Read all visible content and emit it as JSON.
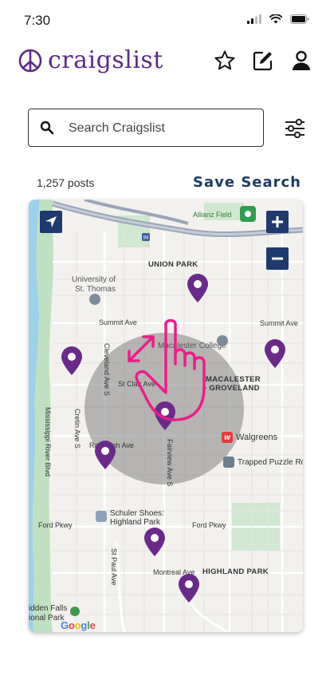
{
  "status": {
    "time": "7:30"
  },
  "header": {
    "logo_text": "craigslist",
    "icons": [
      "star-icon",
      "edit-icon",
      "user-icon"
    ]
  },
  "search": {
    "placeholder": "Search Craigslist"
  },
  "results": {
    "count": "1,257 posts",
    "save_label": "Save Search"
  },
  "map": {
    "labels": {
      "allianz": "Allianz Field",
      "union_park": "UNION PARK",
      "st_thomas_1": "University of",
      "st_thomas_2": "St. Thomas",
      "summit_w": "Summit Ave",
      "summit_e": "Summit Ave",
      "macalester_college": "Macalester College",
      "macalester_groveland_1": "MACALESTER",
      "macalester_groveland_2": "- GROVELAND",
      "st_clair": "St Clair Ave",
      "cleveland": "Cleveland Ave S",
      "fairview": "Fairview Ave S",
      "cretin": "Cretin Ave S",
      "mississippi": "Mississippi River Blvd",
      "randolph": "Randolph Ave",
      "walgreens": "Walgreens",
      "trapped": "Trapped Puzzle Ro",
      "schuler_1": "Schuler Shoes:",
      "schuler_2": "Highland Park",
      "ford_w": "Ford Pkwy",
      "ford_e": "Ford Pkwy",
      "montreal": "Montreal Ave",
      "highland_park": "HIGHLAND PARK",
      "st_paul": "St Paul Ave",
      "hidden_falls_1": "idden Falls",
      "hidden_falls_2": "ional Park",
      "google": "Google",
      "interstate": "94"
    },
    "pin_color": "#6a2a8a",
    "accent_color": "#1e3a6e",
    "gesture_color": "#ee1c8a"
  }
}
